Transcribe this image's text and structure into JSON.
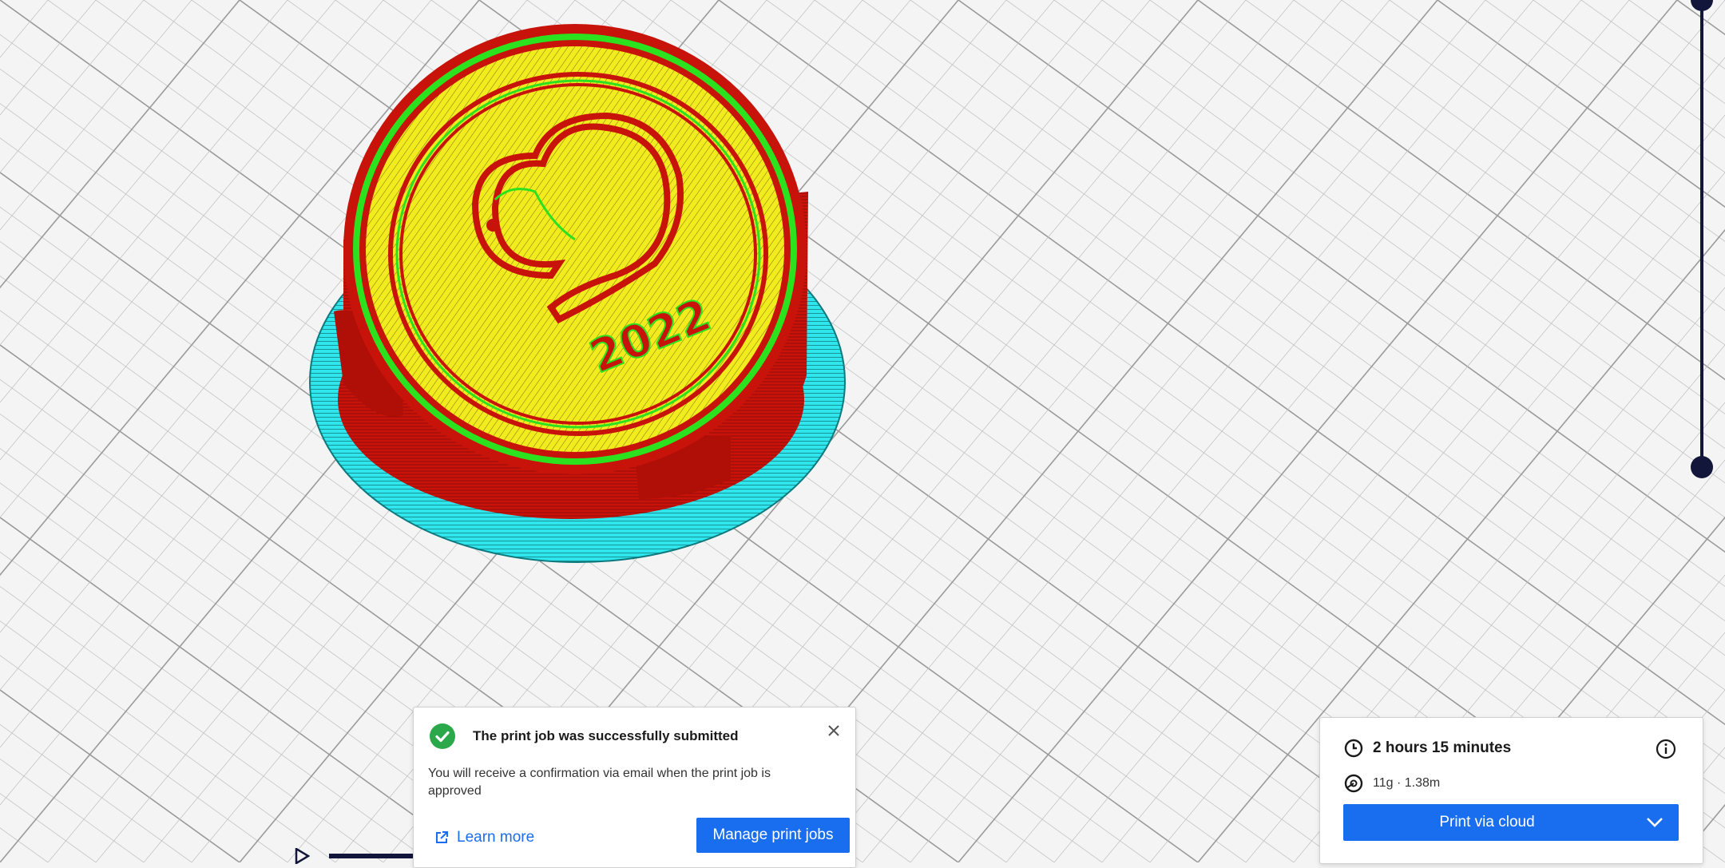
{
  "notification": {
    "title": "The print job was successfully submitted",
    "message": "You will receive a confirmation via email when the print job is approved",
    "learn_more": "Learn more",
    "manage_button": "Manage print jobs"
  },
  "print_panel": {
    "print_time": "2 hours 15 minutes",
    "material": "11g · 1.38m",
    "print_button": "Print via cloud"
  },
  "model": {
    "embossed_text": "2022"
  },
  "colors": {
    "accent": "#196ef0",
    "slider": "#12163a",
    "success": "#2ba84a",
    "wall": "#c8130b",
    "skin": "#f2ec1f",
    "infill_edge": "#1fd21f",
    "skirt": "#2fe6ec"
  },
  "icons": {
    "success": "check-circle-icon",
    "close": "close-icon",
    "external_link": "external-link-icon",
    "clock": "clock-icon",
    "spool": "spool-icon",
    "info": "info-icon",
    "dropdown": "chevron-down-icon",
    "play": "play-icon"
  }
}
